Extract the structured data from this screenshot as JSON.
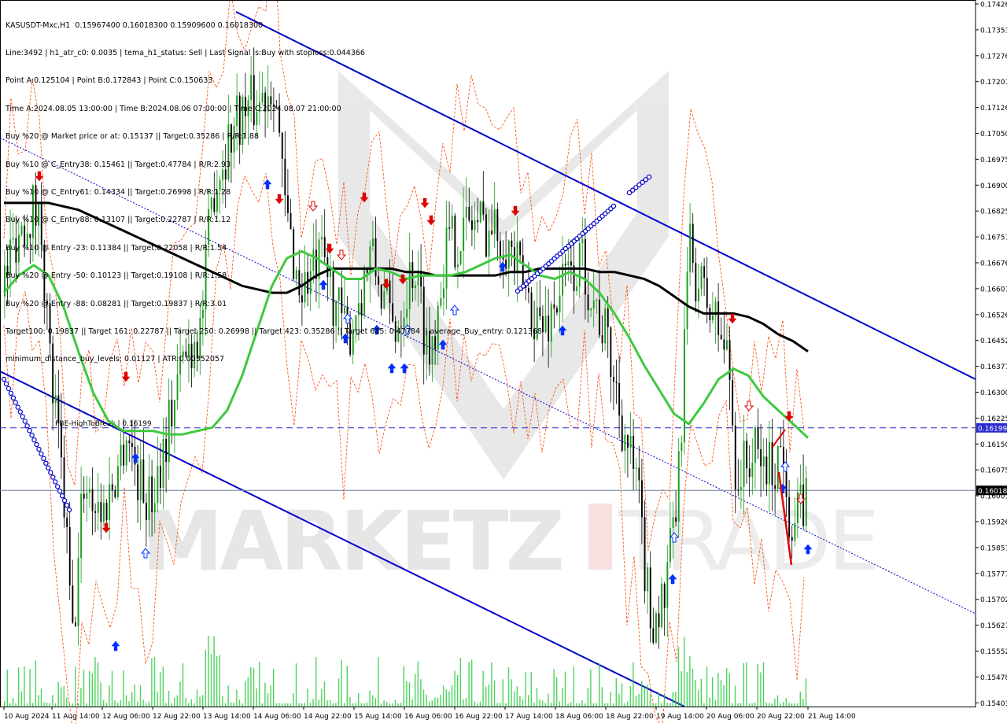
{
  "info_lines": [
    "KASUSDT-Mxc,H1  0.15967400 0.16018300 0.15909600 0.16018300",
    "Line:3492 | h1_atr_c0: 0.0035 | tema_h1_status: Sell | Last Signal is:Buy with stoploss:0.044366",
    "Point A:0.125104 | Point B:0.172843 | Point C:0.150633",
    "Time A:2024.08.05 13:00:00 | Time B:2024.08.06 07:00:00 | Time C:2024.08.07 21:00:00",
    "Buy %20 @ Market price or at: 0.15137 || Target:0.35286 | R/R:1.88",
    "Buy %10 @ C_Entry38: 0.15461 || Target:0.47784 | R/R:2.93",
    "Buy %10 @ C_Entry61: 0.14334 || Target:0.26998 | R/R:1.28",
    "Buy %10 @ C_Entry88: 0.13107 || Target:0.22787 | R/R:1.12",
    "Buy %10 @ Entry -23: 0.11384 || Target:0.22058 | R/R:1.54",
    "Buy %20 @ Entry -50: 0.10123 || Target:0.19108 | R/R:1.58",
    "Buy %20 @ Entry -88: 0.08281 || Target:0.19837 | R/R:3.01",
    "Target100: 0.19837 || Target 161: 0.22787 || Target 250: 0.26998 || Target 423: 0.35286 || Target 685: 0.47784 || average_Buy_entry: 0.121368",
    "minimum_distance_buy_levels: 0.01127 | ATR:0.00352057"
  ],
  "watermark": {
    "left": "MARKETZ",
    "right": "TRADE"
  },
  "colors": {
    "bull": "#1a9a1a",
    "bear": "#000000",
    "ma_long": "#000000",
    "ma_short": "#3ec93e",
    "channel": "#0000cc",
    "envelope": "#ff4500",
    "arrow_up": "#0030ff",
    "arrow_down": "#e00000",
    "price_line": "#7080a0",
    "highbreak_line": "#2a2ad0",
    "volume": "#2ecc40"
  },
  "chart_data": {
    "type": "candlestick",
    "symbol": "KASUSDT-Mxc",
    "timeframe": "H1",
    "ohlc": {
      "open": 0.159674,
      "high": 0.160183,
      "low": 0.159096,
      "close": 0.160183
    },
    "y_ticks": [
      "0.17426",
      "0.17351",
      "0.17276",
      "0.17201",
      "0.17126",
      "0.17050",
      "0.16975",
      "0.16900",
      "0.16825",
      "0.16751",
      "0.16676",
      "0.16601",
      "0.16526",
      "0.16452",
      "0.16377",
      "0.16300",
      "0.16225",
      "0.16150",
      "0.16075",
      "0.16001",
      "0.15926",
      "0.15851",
      "0.15777",
      "0.15702",
      "0.15627",
      "0.15552",
      "0.15478",
      "0.15403"
    ],
    "ylim": [
      0.15403,
      0.17426
    ],
    "x_ticks": [
      "10 Aug 2024",
      "11 Aug 14:00",
      "12 Aug 06:00",
      "12 Aug 22:00",
      "13 Aug 14:00",
      "14 Aug 06:00",
      "14 Aug 22:00",
      "15 Aug 14:00",
      "16 Aug 06:00",
      "16 Aug 22:00",
      "17 Aug 14:00",
      "18 Aug 06:00",
      "18 Aug 22:00",
      "19 Aug 14:00",
      "20 Aug 06:00",
      "20 Aug 22:00",
      "21 Aug 14:00"
    ],
    "current_price_label": "0.16018",
    "high_break_label": "0.16199",
    "high_break_text": "PBE-HighToBreak | 0.16199",
    "ma_long": [
      0.1685,
      0.1685,
      0.1685,
      0.1685,
      0.1684,
      0.1683,
      0.1681,
      0.1679,
      0.1677,
      0.1675,
      0.1673,
      0.1671,
      0.1669,
      0.1667,
      0.1665,
      0.1663,
      0.1661,
      0.166,
      0.1659,
      0.1659,
      0.1661,
      0.1664,
      0.1666,
      0.1666,
      0.1666,
      0.1666,
      0.1666,
      0.1665,
      0.1665,
      0.1664,
      0.1664,
      0.1664,
      0.1664,
      0.1664,
      0.1665,
      0.1665,
      0.1666,
      0.1666,
      0.1666,
      0.1666,
      0.1665,
      0.1665,
      0.1664,
      0.1663,
      0.1661,
      0.1658,
      0.1655,
      0.1653,
      0.1653,
      0.1653,
      0.1652,
      0.165,
      0.1647,
      0.1645,
      0.1642
    ],
    "ma_short": [
      0.1659,
      0.1664,
      0.1667,
      0.1664,
      0.1655,
      0.1642,
      0.163,
      0.1622,
      0.1619,
      0.1619,
      0.1619,
      0.1618,
      0.1618,
      0.1619,
      0.162,
      0.1625,
      0.1635,
      0.1648,
      0.1661,
      0.1669,
      0.1671,
      0.1669,
      0.1666,
      0.1663,
      0.1663,
      0.1666,
      0.1665,
      0.1663,
      0.1664,
      0.1664,
      0.1664,
      0.1665,
      0.1667,
      0.1669,
      0.167,
      0.1667,
      0.1664,
      0.1663,
      0.1665,
      0.1663,
      0.1659,
      0.1653,
      0.1646,
      0.1638,
      0.1631,
      0.1624,
      0.1621,
      0.1627,
      0.1634,
      0.1637,
      0.1635,
      0.1629,
      0.1625,
      0.1621,
      0.1617
    ],
    "grid": false,
    "legend": "none"
  }
}
